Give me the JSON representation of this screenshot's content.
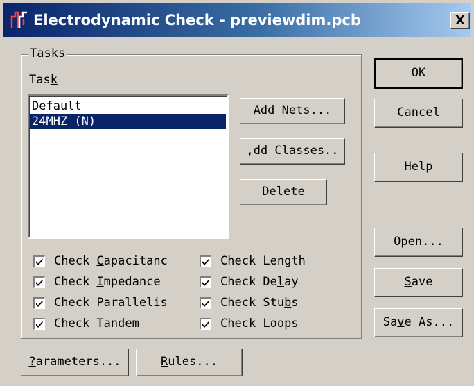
{
  "window": {
    "title": "Electrodynamic Check - previewdim.pcb",
    "close_label": "X"
  },
  "tasks_group": {
    "legend": "Tasks",
    "task_label_pre": "Tas",
    "task_label_mn": "k",
    "task_list": [
      "Default",
      "24MHZ (N)"
    ],
    "selected_index": 1
  },
  "buttons": {
    "add_nets_pre": "Add ",
    "add_nets_mn": "N",
    "add_nets_post": "ets...",
    "add_classes": ",dd Classes..",
    "delete_mn": "D",
    "delete_post": "elete",
    "ok": "OK",
    "cancel": "Cancel",
    "help_mn": "H",
    "help_post": "elp",
    "open_mn": "O",
    "open_post": "pen...",
    "save_mn": "S",
    "save_post": "ave",
    "save_as_pre": "Sa",
    "save_as_mn": "v",
    "save_as_post": "e As...",
    "parameters_mn": "?",
    "parameters_post": "arameters...",
    "rules_mn": "R",
    "rules_post": "ules..."
  },
  "checks": {
    "capacitance": {
      "pre": "Check ",
      "mn": "C",
      "post": "apacitanc",
      "checked": true
    },
    "impedance": {
      "pre": "Check ",
      "mn": "I",
      "post": "mpedance",
      "checked": true
    },
    "parallelism": {
      "pre": "Check Parallelis",
      "mn": "",
      "post": "",
      "checked": true
    },
    "tandem": {
      "pre": "Check ",
      "mn": "T",
      "post": "andem",
      "checked": true
    },
    "length": {
      "pre": "Check Length",
      "mn": "",
      "post": "",
      "checked": true
    },
    "delay": {
      "pre": "Check De",
      "mn": "l",
      "post": "ay",
      "checked": true
    },
    "stubs": {
      "pre": "Check Stu",
      "mn": "b",
      "post": "s",
      "checked": true
    },
    "loops": {
      "pre": "Check ",
      "mn": "L",
      "post": "oops",
      "checked": true
    }
  },
  "colors": {
    "face": "#d4d0c8",
    "titlebar_start": "#0a246a",
    "titlebar_end": "#a6caf0",
    "selection": "#0a246a"
  }
}
